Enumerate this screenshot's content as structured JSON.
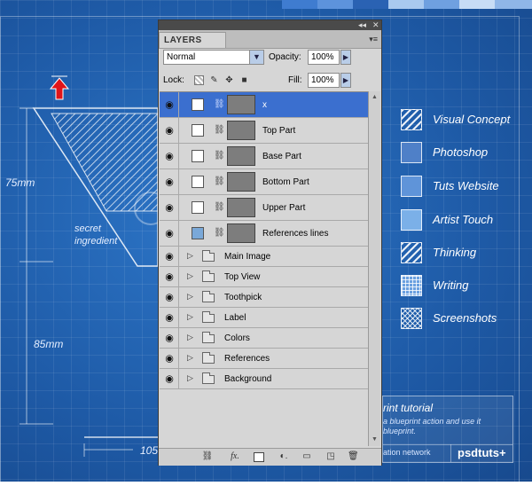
{
  "background": {
    "measure_75": "75mm",
    "measure_85": "85mm",
    "measure_105": "105",
    "secret_line1": "secret",
    "secret_line2": "ingredient",
    "legend": [
      {
        "label": "Visual Concept",
        "style": "hatched"
      },
      {
        "label": "Photoshop",
        "style": "solid-dark"
      },
      {
        "label": "Tuts Website",
        "style": "solid-mid"
      },
      {
        "label": "Artist Touch",
        "style": "solid-light"
      },
      {
        "label": "Thinking",
        "style": "hatched"
      },
      {
        "label": "Writing",
        "style": "grid"
      },
      {
        "label": "Screenshots",
        "style": "crosshatch"
      }
    ],
    "footer_title": "rint tutorial",
    "footer_desc_line1": "a blueprint action and use it",
    "footer_desc_line2": "blueprint.",
    "footer_network": "ation network",
    "footer_brand": "psdtuts+",
    "colors": {
      "blueprint": "#1f5fae",
      "arrow": "#e0141a"
    }
  },
  "panel": {
    "collapse_glyph": "◂◂",
    "close_glyph": "✕",
    "tab_label": "LAYERS",
    "menu_glyph": "▾≡",
    "blend_mode": "Normal",
    "opacity_label": "Opacity:",
    "opacity_value": "100%",
    "lock_label": "Lock:",
    "fill_label": "Fill:",
    "fill_value": "100%",
    "layers": [
      {
        "name": "x",
        "selected": true
      },
      {
        "name": "Top Part",
        "selected": false
      },
      {
        "name": "Base Part",
        "selected": false
      },
      {
        "name": "Bottom Part",
        "selected": false
      },
      {
        "name": "Upper Part",
        "selected": false
      },
      {
        "name": "References lines",
        "selected": false
      }
    ],
    "groups": [
      "Main Image",
      "Top View",
      "Toothpick",
      "Label",
      "Colors",
      "References",
      "Background"
    ],
    "bottom_icons": [
      "link-icon",
      "fx-icon",
      "mask-icon",
      "adjustment-icon",
      "folder-icon",
      "new-layer-icon",
      "trash-icon"
    ],
    "colors": {
      "selected_row": "#3b6fcf",
      "panel_bg": "#d6d6d6"
    }
  }
}
